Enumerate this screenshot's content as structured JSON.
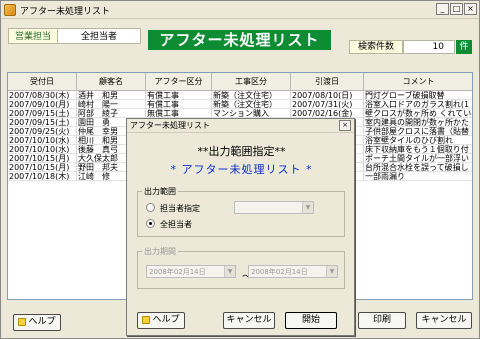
{
  "window": {
    "title": "アフター未処理リスト",
    "controls": {
      "minimize": "_",
      "maximize": "□",
      "close": "×"
    }
  },
  "header": {
    "sales_tab": "営業担当",
    "all_tab": "全担当者",
    "banner": "アフター未処理リスト",
    "count_label": "検索件数",
    "count_value": "10",
    "count_unit": "件"
  },
  "colors": {
    "banner": "#0d8c33",
    "subtitle": "#0a2dcf"
  },
  "grid": {
    "columns": [
      "受付日",
      "顧客名",
      "アフター区分",
      "工事区分",
      "引渡日",
      "コメント"
    ],
    "rows": [
      [
        "2007/08/30(木)",
        "酒井　和男",
        "有償工事",
        "新築（注文住宅）",
        "2007/08/10(日)",
        "門灯グローブ破損取替"
      ],
      [
        "2007/09/10(月)",
        "崎村　陽一",
        "有償工事",
        "新築（注文住宅）",
        "2007/07/31(火)",
        "浴室入口ドアのガラス割れ(1"
      ],
      [
        "2007/09/15(土)",
        "阿部　綾子",
        "無償工事",
        "マンション購入",
        "2007/02/16(金)",
        "壁クロスが数ヶ所め くれてい"
      ],
      [
        "2007/09/15(土)",
        "園田　勇",
        "",
        "",
        "",
        "室内建具の開閉が数ヶ所かた"
      ],
      [
        "2007/09/25(火)",
        "仲尾　幸男",
        "",
        "",
        "",
        "子供部屋クロスに落書（貼替"
      ],
      [
        "2007/10/10(水)",
        "相川　和男",
        "",
        "",
        "",
        "浴室壁タイルのひび割れ"
      ],
      [
        "2007/10/10(水)",
        "後藤　真弓",
        "",
        "",
        "",
        "床下収納庫をもう１個取り付"
      ],
      [
        "2007/10/15(月)",
        "大久保太郎",
        "",
        "",
        "",
        "ポーチ土間タイルが一部浮い"
      ],
      [
        "2007/10/15(月)",
        "野田　邦夫",
        "",
        "",
        "",
        "台所混合水栓を誤って破損し"
      ],
      [
        "2007/10/18(木)",
        "江崎　修",
        "",
        "",
        "",
        "一部雨漏り"
      ]
    ]
  },
  "footer": {
    "help": "ヘルプ",
    "print": "印刷",
    "cancel": "キャンセル"
  },
  "dialog": {
    "title": "アフター未処理リスト",
    "close": "×",
    "heading": "**出力範囲指定**",
    "subtitle": "* アフター未処理リスト *",
    "range_legend": "出力範囲",
    "option_assigned": "担当者指定",
    "option_all": "全担当者",
    "period_legend": "出力期間",
    "date_from": "2008年02月14日",
    "date_to": "2008年02月14日",
    "tilde": "〜",
    "help": "ヘルプ",
    "cancel": "キャンセル",
    "start": "開始"
  }
}
